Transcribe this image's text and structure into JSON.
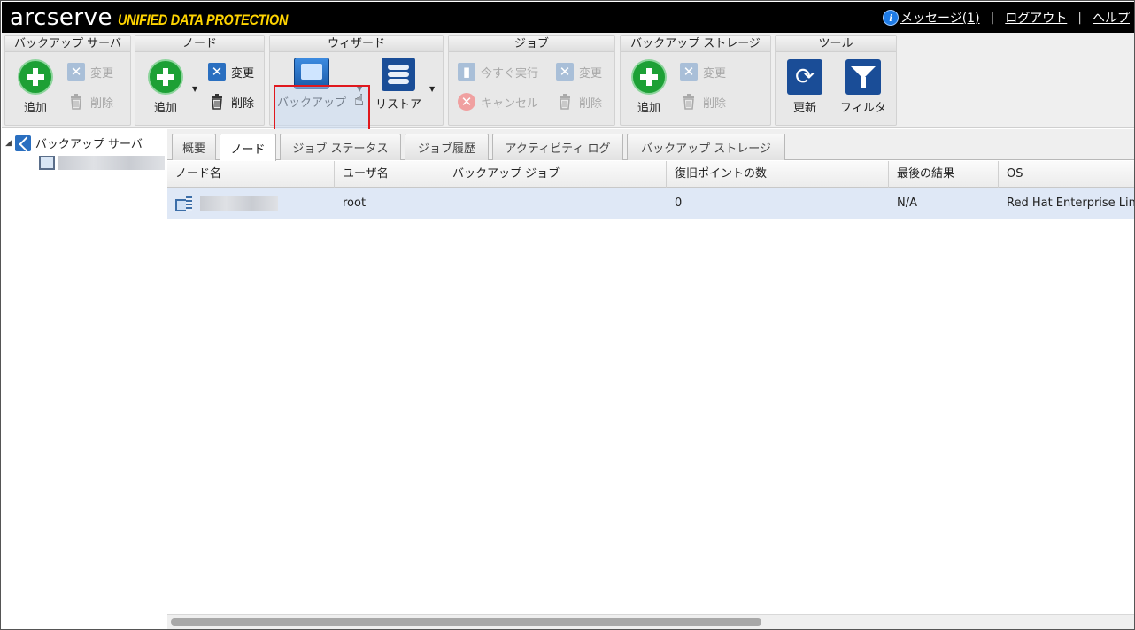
{
  "header": {
    "logo_main": "arcserve",
    "logo_sub": "UNIFIED DATA PROTECTION",
    "messages_link": "メッセージ(1)",
    "logout_link": "ログアウト",
    "help_link": "ヘルプ",
    "separator": "|"
  },
  "ribbon": {
    "groups": [
      {
        "title": "バックアップ サーバ",
        "add": "追加",
        "edit": "変更",
        "delete": "削除"
      },
      {
        "title": "ノード",
        "add": "追加",
        "edit": "変更",
        "delete": "削除"
      },
      {
        "title": "ウィザード",
        "backup": "バックアップ",
        "restore": "リストア"
      },
      {
        "title": "ジョブ",
        "run_now": "今すぐ実行",
        "edit": "変更",
        "cancel": "キャンセル",
        "delete": "削除"
      },
      {
        "title": "バックアップ ストレージ",
        "add": "追加",
        "edit": "変更",
        "delete": "削除"
      },
      {
        "title": "ツール",
        "refresh": "更新",
        "filter": "フィルタ"
      }
    ]
  },
  "tree": {
    "root_label": "バックアップ サーバ"
  },
  "tabs": [
    "概要",
    "ノード",
    "ジョブ ステータス",
    "ジョブ履歴",
    "アクティビティ ログ",
    "バックアップ ストレージ"
  ],
  "active_tab": "ノード",
  "grid": {
    "columns": [
      "ノード名",
      "ユーザ名",
      "バックアップ ジョブ",
      "復旧ポイントの数",
      "最後の結果",
      "OS"
    ],
    "rows": [
      {
        "node_name": "",
        "user": "root",
        "backup_job": "",
        "recovery_points": "0",
        "last_result": "N/A",
        "os": "Red Hat Enterprise Linu"
      }
    ]
  },
  "colors": {
    "accent_red": "#e0181e",
    "logo_yellow": "#ffd400",
    "selected_row": "#dfe8f6"
  }
}
